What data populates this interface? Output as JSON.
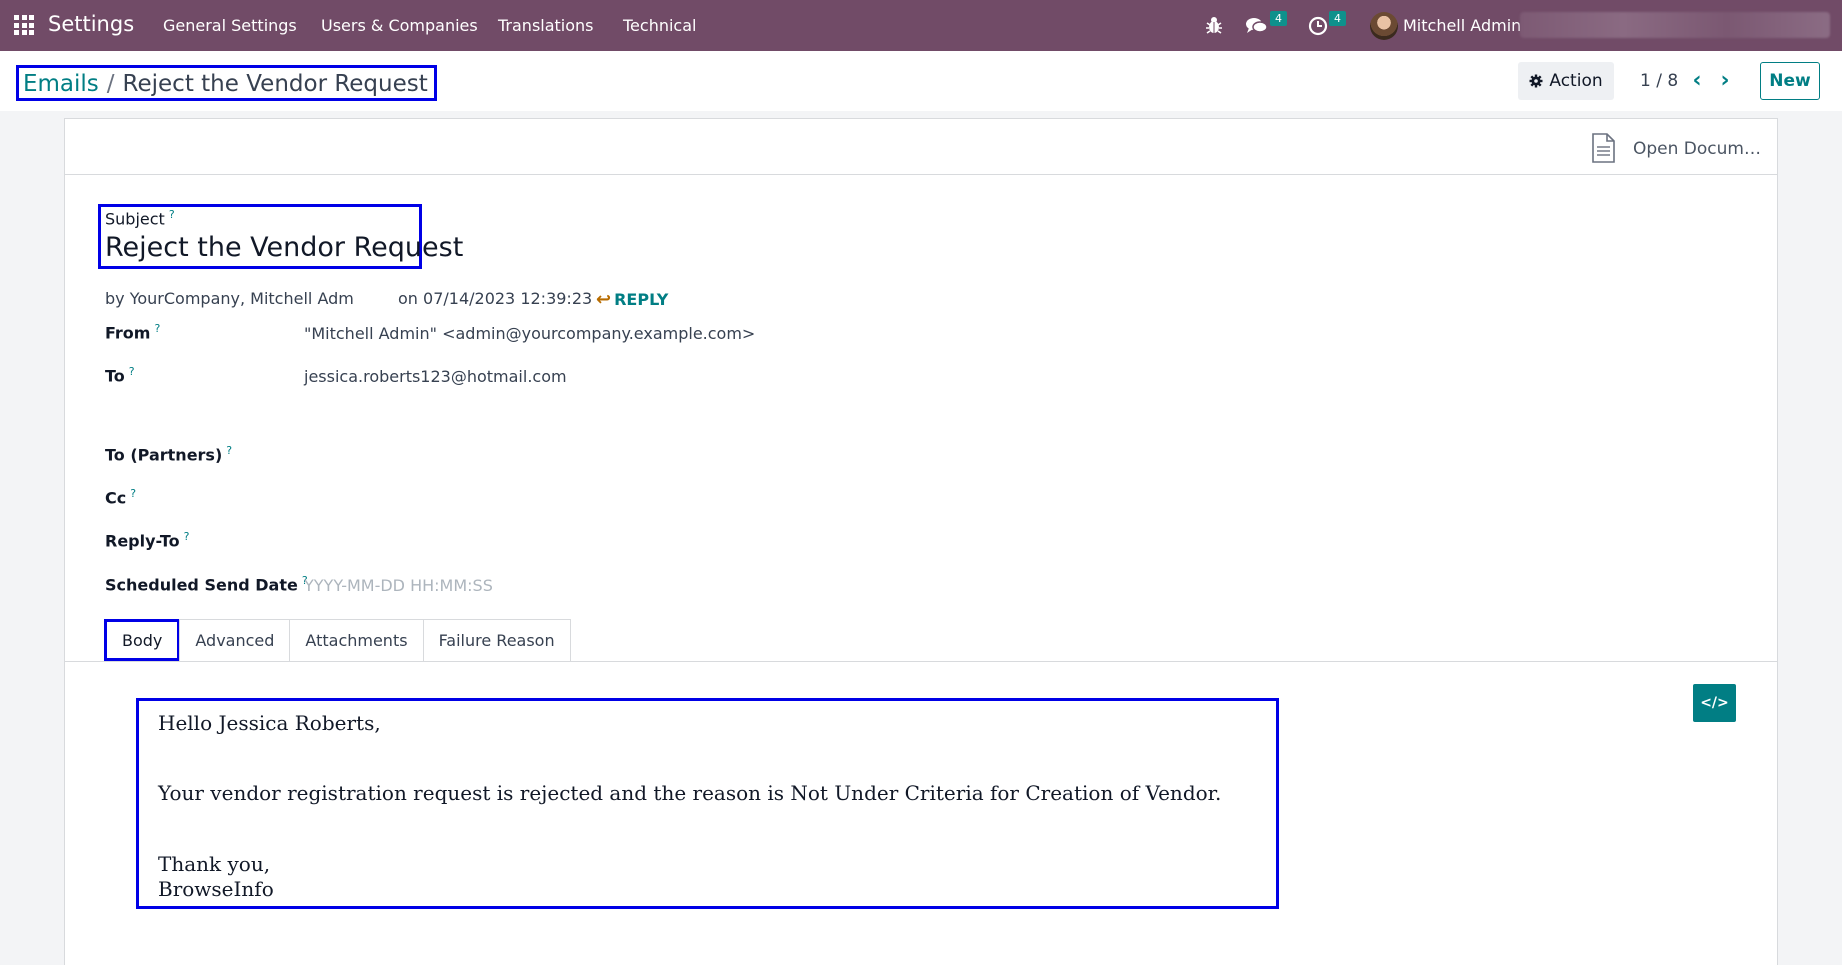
{
  "navbar": {
    "app_title": "Settings",
    "menu": [
      "General Settings",
      "Users & Companies",
      "Translations",
      "Technical"
    ],
    "messages_count": "4",
    "activities_count": "4",
    "user_name": "Mitchell Admin"
  },
  "breadcrumb": {
    "parent": "Emails",
    "separator": "/",
    "current": "Reject the Vendor Request"
  },
  "control": {
    "action_label": "Action",
    "pager": "1 / 8",
    "new_label": "New"
  },
  "statusbar": {
    "open_document_label": "Open Docum…"
  },
  "form": {
    "subject_label": "Subject",
    "help_mark": "?",
    "subject_value": "Reject the Vendor Request",
    "author": "by YourCompany, Mitchell Adm",
    "date": "on 07/14/2023 12:39:23",
    "reply_label": "REPLY",
    "fields": {
      "from_label": "From",
      "from_value": "\"Mitchell Admin\" <admin@yourcompany.example.com>",
      "to_label": "To",
      "to_value": "jessica.roberts123@hotmail.com",
      "to_partners_label": "To (Partners)",
      "cc_label": "Cc",
      "reply_to_label": "Reply-To",
      "scheduled_label": "Scheduled Send Date",
      "scheduled_placeholder": "YYYY-MM-DD HH:MM:SS"
    }
  },
  "tabs": [
    "Body",
    "Advanced",
    "Attachments",
    "Failure Reason"
  ],
  "body": {
    "greeting": "Hello Jessica Roberts,",
    "message": "Your vendor registration request is rejected and the reason is Not Under Criteria for Creation of Vendor.",
    "closing": "Thank you,",
    "signature": "BrowseInfo"
  },
  "colors": {
    "navbar": "#714b67",
    "accent": "#017e84",
    "highlight_box": "#0000e6"
  }
}
